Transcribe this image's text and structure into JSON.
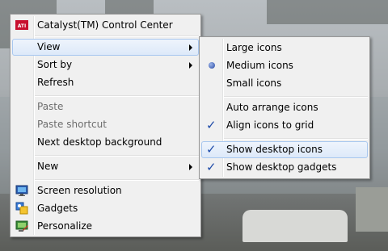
{
  "context_menu": {
    "items": [
      {
        "label": "Catalyst(TM) Control Center",
        "icon": "ati-catalyst-icon"
      },
      {
        "label": "View",
        "submenu": true
      },
      {
        "label": "Sort by",
        "submenu": true
      },
      {
        "label": "Refresh"
      },
      {
        "label": "Paste",
        "disabled": true
      },
      {
        "label": "Paste shortcut",
        "disabled": true
      },
      {
        "label": "Next desktop background"
      },
      {
        "label": "New",
        "submenu": true
      },
      {
        "label": "Screen resolution",
        "icon": "monitor-icon"
      },
      {
        "label": "Gadgets",
        "icon": "gadgets-icon"
      },
      {
        "label": "Personalize",
        "icon": "personalize-icon"
      }
    ]
  },
  "view_submenu": {
    "items": [
      {
        "label": "Large icons"
      },
      {
        "label": "Medium icons",
        "selected": true
      },
      {
        "label": "Small icons"
      },
      {
        "label": "Auto arrange icons"
      },
      {
        "label": "Align icons to grid",
        "checked": true
      },
      {
        "label": "Show desktop icons",
        "checked": true,
        "highlighted": true
      },
      {
        "label": "Show desktop gadgets",
        "checked": true
      }
    ]
  },
  "colors": {
    "menu_background": "#f0f0f0",
    "highlight_border": "#a8c7ef",
    "check_color": "#1d4aa8",
    "disabled_text": "#6d6d6d"
  }
}
